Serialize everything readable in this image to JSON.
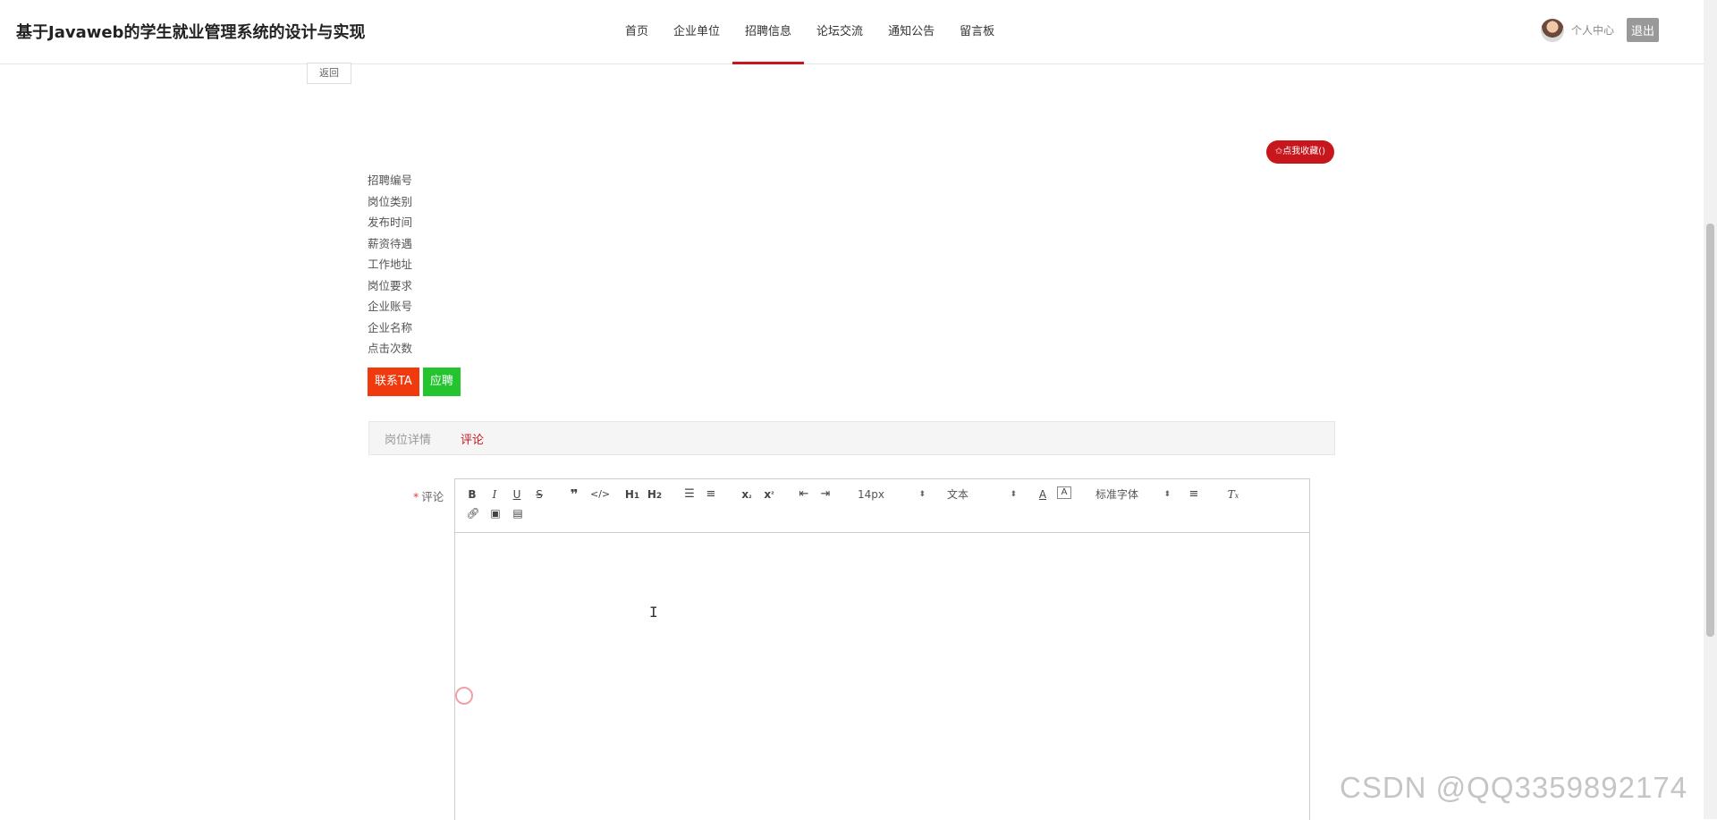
{
  "header": {
    "site_title": "基于Javaweb的学生就业管理系统的设计与实现",
    "nav": [
      {
        "label": "首页",
        "active": false
      },
      {
        "label": "企业单位",
        "active": false
      },
      {
        "label": "招聘信息",
        "active": true
      },
      {
        "label": "论坛交流",
        "active": false
      },
      {
        "label": "通知公告",
        "active": false
      },
      {
        "label": "留言板",
        "active": false
      }
    ],
    "user_center_label": "个人中心",
    "logout_label": "退出"
  },
  "page": {
    "back_label": "返回",
    "favorite_label": "✩点我收藏()",
    "fields": [
      "招聘编号",
      "岗位类别",
      "发布时间",
      "薪资待遇",
      "工作地址",
      "岗位要求",
      "企业账号",
      "企业名称",
      "点击次数"
    ],
    "contact_label": "联系TA",
    "apply_label": "应聘",
    "tabs": [
      {
        "label": "岗位详情",
        "active": false
      },
      {
        "label": "评论",
        "active": true
      }
    ],
    "comment_label": "评论",
    "required_mark": "*"
  },
  "editor": {
    "font_size_value": "14px",
    "header_value": "文本",
    "font_family_value": "标准字体",
    "icons": [
      "bold-icon",
      "italic-icon",
      "underline-icon",
      "strike-icon",
      "blockquote-icon",
      "code-block-icon",
      "h1-icon",
      "h2-icon",
      "ordered-list-icon",
      "bullet-list-icon",
      "subscript-icon",
      "superscript-icon",
      "outdent-icon",
      "indent-icon",
      "font-color-icon",
      "background-color-icon",
      "align-icon",
      "clear-format-icon",
      "link-icon",
      "image-icon",
      "video-icon"
    ]
  },
  "watermark": "CSDN @QQ3359892174"
}
